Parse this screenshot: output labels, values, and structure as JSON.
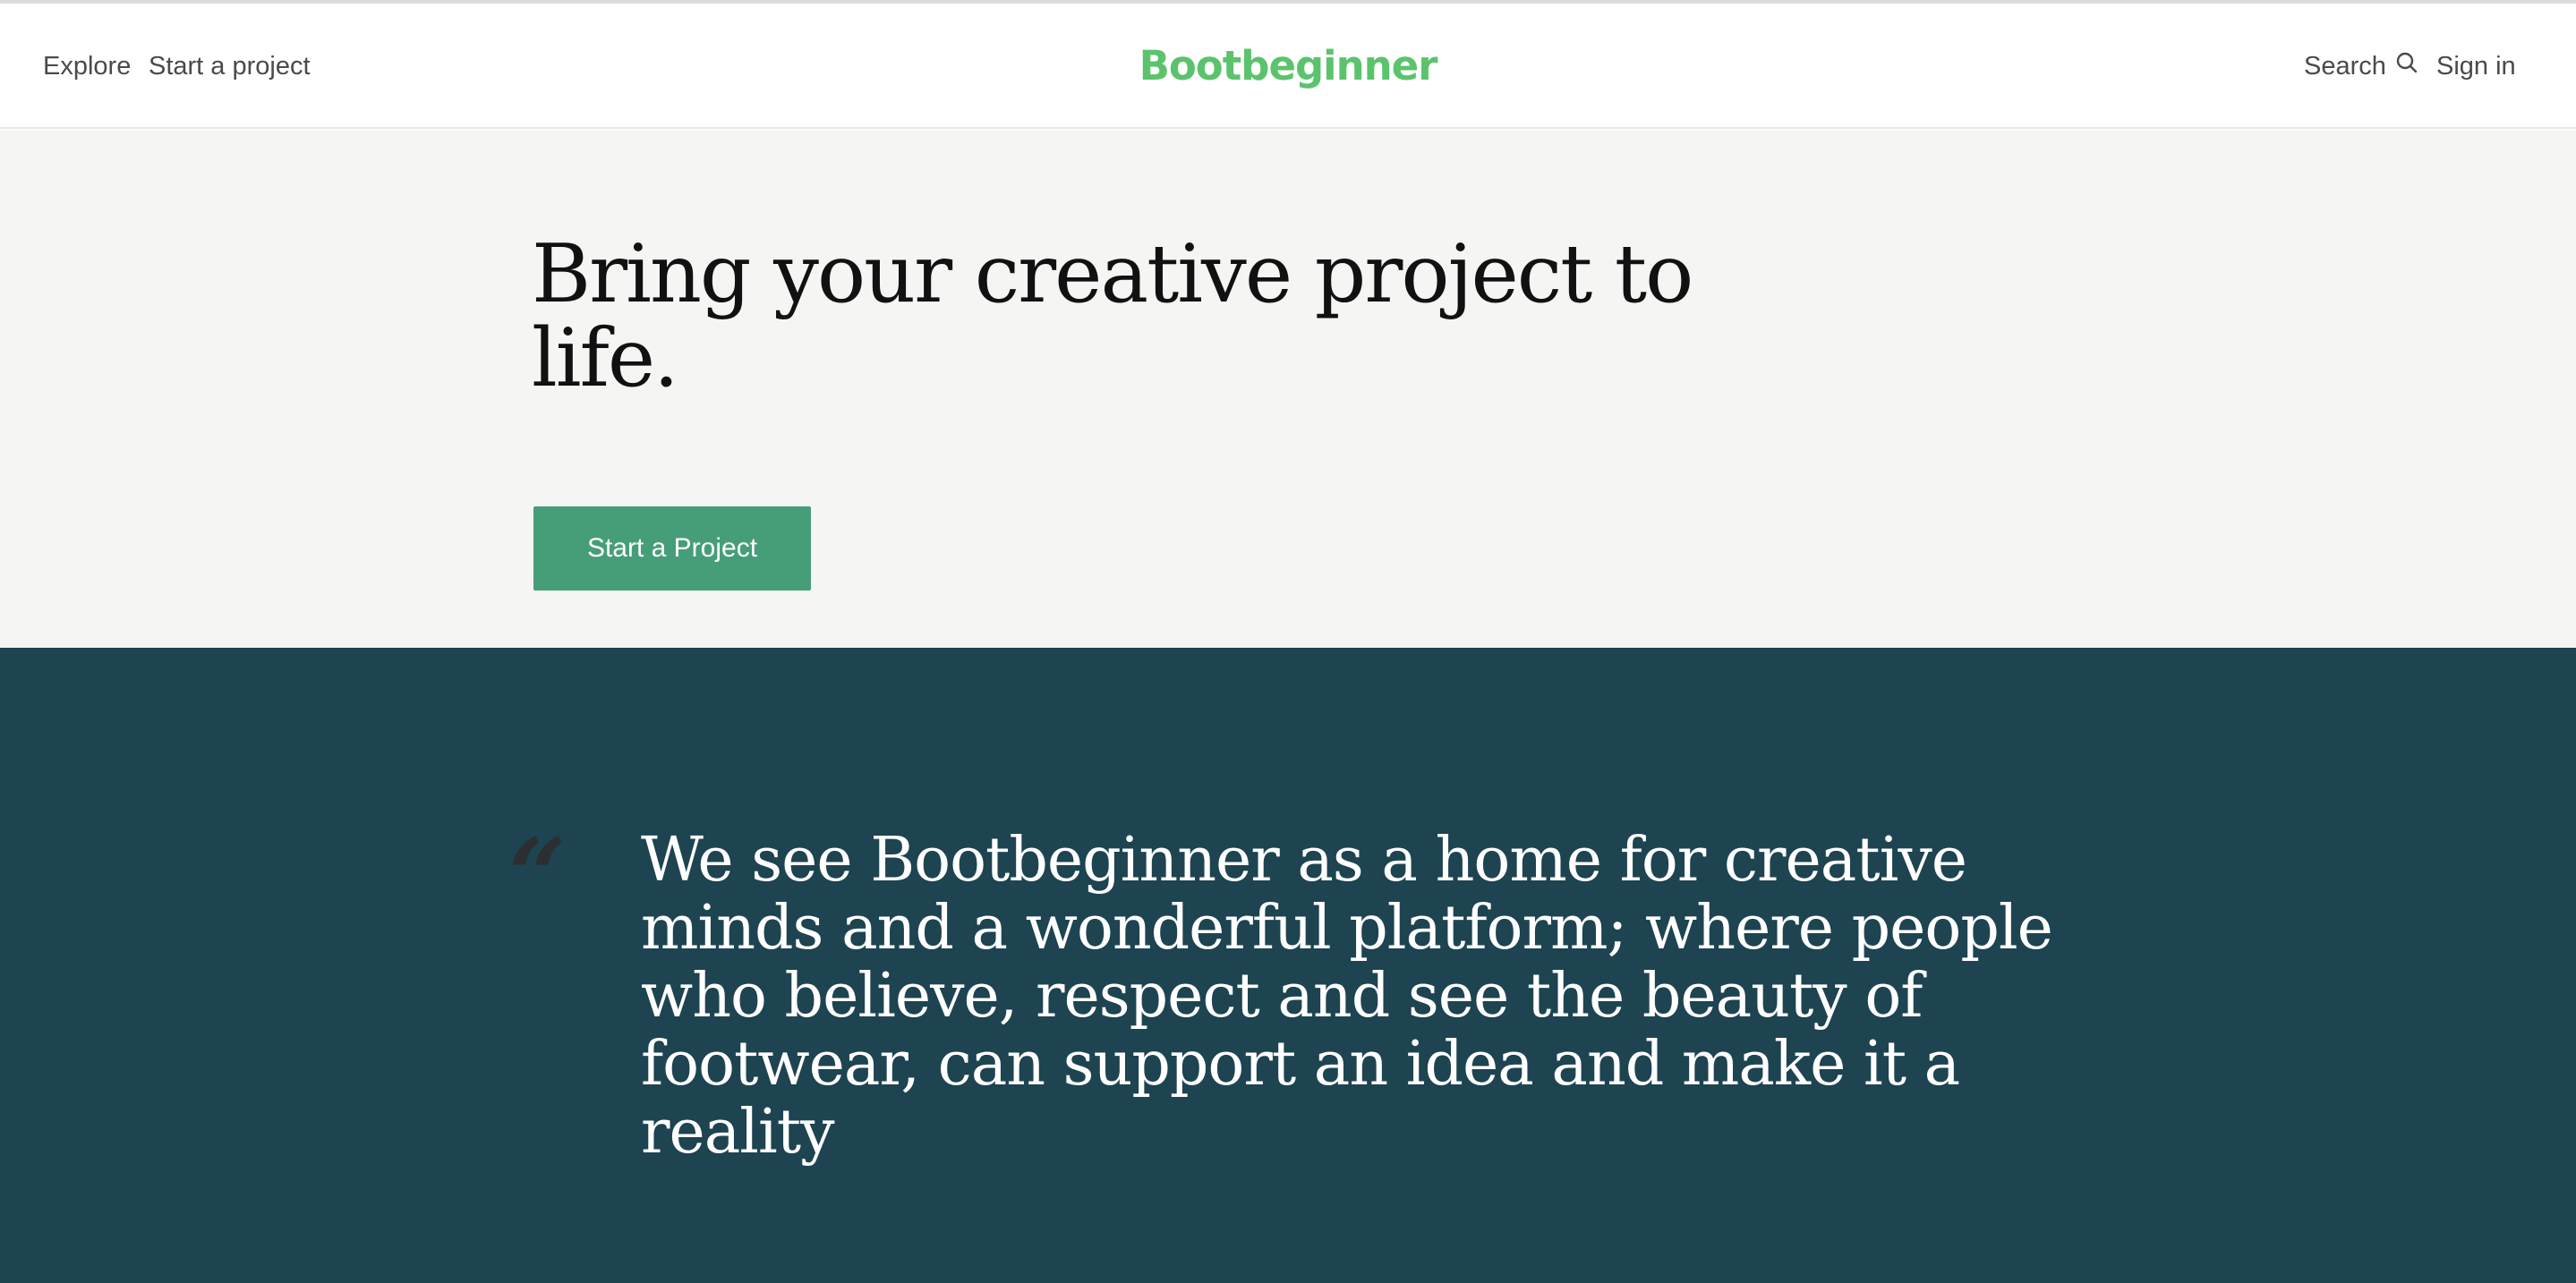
{
  "colors": {
    "brand": "#5cc36d",
    "button_bg": "#469e79",
    "quote_bg": "#1d4450",
    "quote_mark": "#2b2f31",
    "nav_text": "#4a4a4a"
  },
  "nav": {
    "left_links": [
      "Explore",
      "Start a project"
    ],
    "brand": "Bootbeginner",
    "search_label": "Search",
    "search_icon": "search-icon",
    "signin_label": "Sign in"
  },
  "hero": {
    "title": "Bring your creative project to life.",
    "button_label": "Start a Project"
  },
  "quote": {
    "mark": "“",
    "text": "We see Bootbeginner as a home for creative minds and a wonderful platform; where people who believe, respect and see the beauty of footwear, can support an idea and make it a reality"
  }
}
